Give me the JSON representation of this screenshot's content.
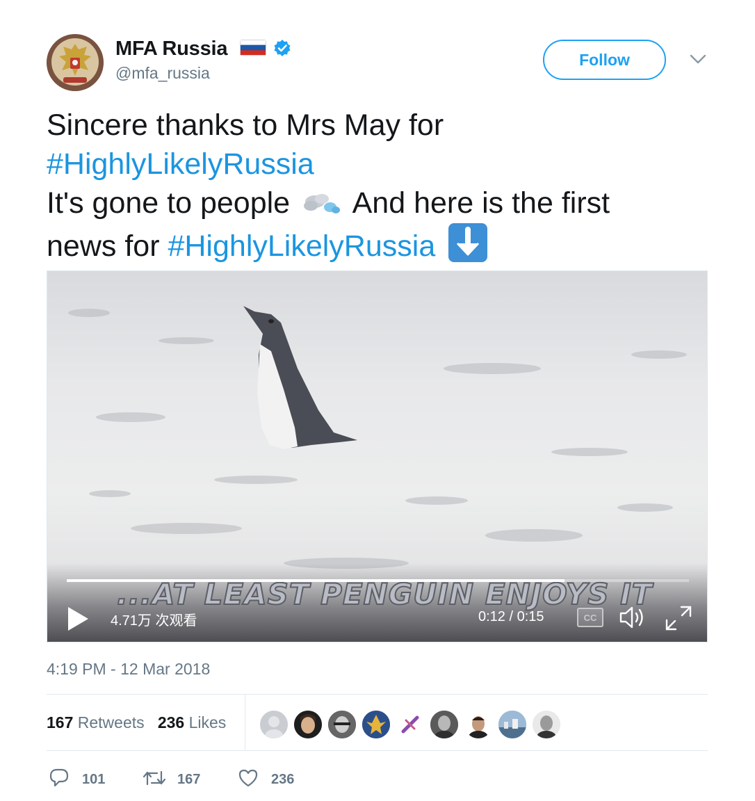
{
  "author": {
    "name": "MFA Russia",
    "handle": "@mfa_russia",
    "avatar_icon": "russian-coat-of-arms-icon",
    "flag_icon": "russia-flag-icon",
    "verified_icon": "verified-badge-icon"
  },
  "follow_label": "Follow",
  "tweet": {
    "line1": "Sincere thanks to Mrs May for",
    "hashtag1": "#HighlyLikelyRussia",
    "line3": "It's gone to people",
    "line3b": "And here is the first",
    "line4": "news for",
    "hashtag2": "#HighlyLikelyRussia",
    "emoji1": "dashing-away-icon",
    "emoji2": "down-arrow-icon"
  },
  "video": {
    "caption": "...AT LEAST PENGUIN ENJOYS IT",
    "views": "4.71万 次观看",
    "time": "0:12 / 0:15",
    "cc_label": "CC",
    "progress": 0.8
  },
  "timestamp": "4:19 PM - 12 Mar 2018",
  "stats": {
    "retweets_count": "167",
    "retweets_label": "Retweets",
    "likes_count": "236",
    "likes_label": "Likes"
  },
  "actions": {
    "replies": "101",
    "retweets": "167",
    "likes": "236"
  },
  "colors": {
    "accent": "#1da1f2",
    "hashtag": "#1b95e0",
    "secondary_text": "#657786"
  }
}
